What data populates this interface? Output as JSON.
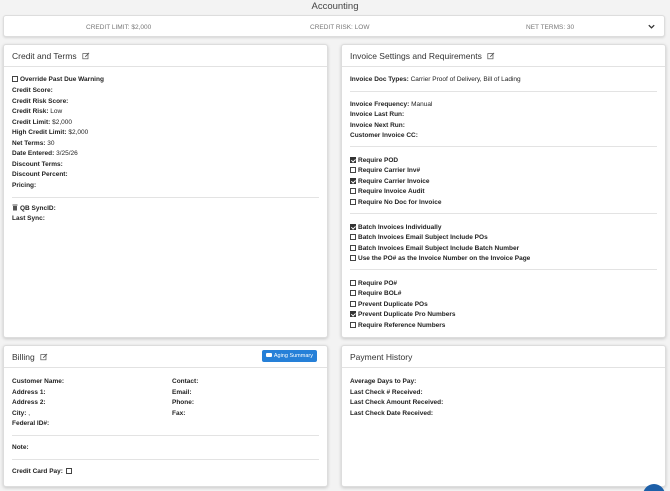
{
  "page_title": "Accounting",
  "summary": {
    "credit_limit": "CREDIT LIMIT: $2,000",
    "credit_risk": "CREDIT RISK: LOW",
    "net_terms": "NET TERMS: 30"
  },
  "credit": {
    "title": "Credit and Terms",
    "override_label": "Override Past Due Warning",
    "override_checked": false,
    "fields": [
      {
        "label": "Credit Score:",
        "value": ""
      },
      {
        "label": "Credit Risk Score:",
        "value": ""
      },
      {
        "label": "Credit Risk:",
        "value": "Low"
      },
      {
        "label": "Credit Limit:",
        "value": "$2,000"
      },
      {
        "label": "High Credit Limit:",
        "value": "$2,000"
      },
      {
        "label": "Net Terms:",
        "value": "30"
      },
      {
        "label": "Date Entered:",
        "value": "3/25/26"
      },
      {
        "label": "Discount Terms:",
        "value": ""
      },
      {
        "label": "Discount Percent:",
        "value": ""
      },
      {
        "label": "Pricing:",
        "value": ""
      }
    ],
    "qb_sync_label": "QB SyncID:",
    "last_sync_label": "Last Sync:"
  },
  "invoice": {
    "title": "Invoice Settings and Requirements",
    "doc_types_label": "Invoice Doc Types:",
    "doc_types_value": "Carrier Proof of Delivery, Bill of Lading",
    "frequency_label": "Invoice Frequency:",
    "frequency_value": "Manual",
    "last_run_label": "Invoice Last Run:",
    "next_run_label": "Invoice Next Run:",
    "cc_label": "Customer Invoice CC:",
    "group1": [
      {
        "label": "Require POD",
        "checked": true
      },
      {
        "label": "Require Carrier Inv#",
        "checked": false
      },
      {
        "label": "Require Carrier Invoice",
        "checked": true
      },
      {
        "label": "Require Invoice Audit",
        "checked": false
      },
      {
        "label": "Require No Doc for Invoice",
        "checked": false
      }
    ],
    "group2": [
      {
        "label": "Batch Invoices Individually",
        "checked": true
      },
      {
        "label": "Batch Invoices Email Subject Include POs",
        "checked": false
      },
      {
        "label": "Batch Invoices Email Subject Include Batch Number",
        "checked": false
      },
      {
        "label": "Use the PO# as the Invoice Number on the Invoice Page",
        "checked": false
      }
    ],
    "group3": [
      {
        "label": "Require PO#",
        "checked": false
      },
      {
        "label": "Require BOL#",
        "checked": false
      },
      {
        "label": "Prevent Duplicate POs",
        "checked": false
      },
      {
        "label": "Prevent Duplicate Pro Numbers",
        "checked": true
      },
      {
        "label": "Require Reference Numbers",
        "checked": false
      }
    ]
  },
  "billing": {
    "title": "Billing",
    "aging_button": "Aging Summary",
    "left_fields": [
      "Customer Name:",
      "Address 1:",
      "Address 2:",
      "City:",
      "Federal ID#:"
    ],
    "city_value": ",",
    "right_fields": [
      "Contact:",
      "Email:",
      "Phone:",
      "Fax:"
    ],
    "note_label": "Note:",
    "credit_card_label": "Credit Card Pay:"
  },
  "payment": {
    "title": "Payment History",
    "fields": [
      "Average Days to Pay:",
      "Last Check # Received:",
      "Last Check Amount Received:",
      "Last Check Date Received:"
    ]
  },
  "icons": {
    "edit": "edit-icon",
    "trash": "trash-icon",
    "chevron": "chevron-down-icon",
    "aging": "card-icon"
  },
  "colors": {
    "primary_button": "#2680d8"
  }
}
